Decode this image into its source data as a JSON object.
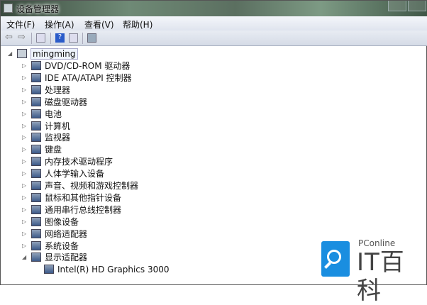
{
  "window": {
    "title": "设备管理器"
  },
  "menu": [
    "文件(F)",
    "操作(A)",
    "查看(V)",
    "帮助(H)"
  ],
  "toolbar": [
    "back-icon",
    "forward-icon",
    "properties-icon",
    "help-icon",
    "view-icon",
    "scan-hardware-icon"
  ],
  "tree": {
    "root": "mingming",
    "items": [
      "DVD/CD-ROM 驱动器",
      "IDE ATA/ATAPI 控制器",
      "处理器",
      "磁盘驱动器",
      "电池",
      "计算机",
      "监视器",
      "键盘",
      "内存技术驱动程序",
      "人体学输入设备",
      "声音、视频和游戏控制器",
      "鼠标和其他指针设备",
      "通用串行总线控制器",
      "图像设备",
      "网络适配器",
      "系统设备",
      "显示适配器"
    ],
    "expanded_child": "Intel(R) HD Graphics 3000"
  },
  "watermark": {
    "brand": "PConline",
    "name": "IT百科",
    "color": "#1a8ee0"
  }
}
